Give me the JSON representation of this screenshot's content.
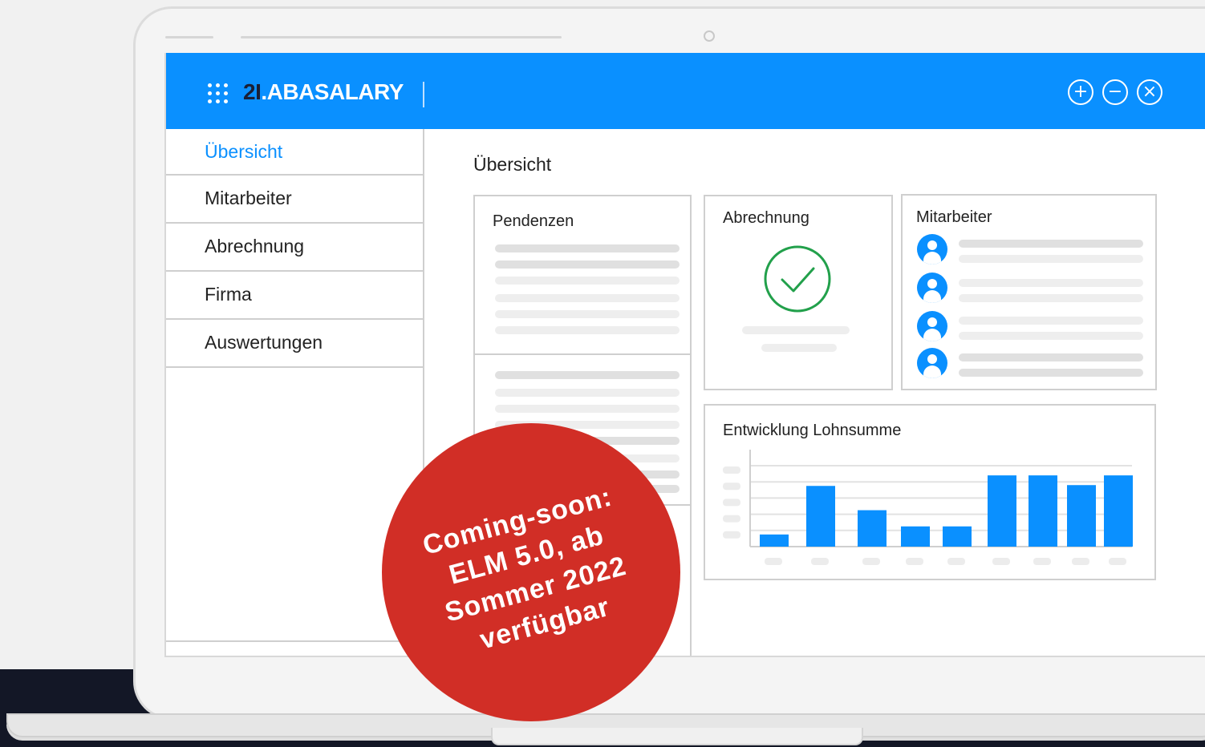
{
  "app": {
    "brand_number": "2I",
    "brand_name": ".ABASALARY"
  },
  "window_controls": {
    "add_glyph": "+",
    "minimize_glyph": "−",
    "close_glyph": "×"
  },
  "sidebar": {
    "items": [
      {
        "label": "Übersicht",
        "active": true
      },
      {
        "label": "Mitarbeiter",
        "active": false
      },
      {
        "label": "Abrechnung",
        "active": false
      },
      {
        "label": "Firma",
        "active": false
      },
      {
        "label": "Auswertungen",
        "active": false
      }
    ]
  },
  "main": {
    "title": "Übersicht",
    "cards": {
      "pendenzen": "Pendenzen",
      "abrechnung": "Abrechnung",
      "mitarbeiter": "Mitarbeiter",
      "lohnsumme": "Entwicklung Lohnsumme"
    }
  },
  "badge": {
    "line1": "Coming-soon:",
    "line2": "ELM 5.0, ab",
    "line3": "Sommer 2022",
    "line4": "verfügbar"
  },
  "colors": {
    "accent": "#0a90ff",
    "success": "#22a04b",
    "badge": "#d12e26"
  },
  "chart_data": {
    "type": "bar",
    "values": [
      1.5,
      7.5,
      4.5,
      2.5,
      2.5,
      8.8,
      8.8,
      7.6,
      8.8
    ],
    "ylim": [
      0,
      10
    ]
  }
}
